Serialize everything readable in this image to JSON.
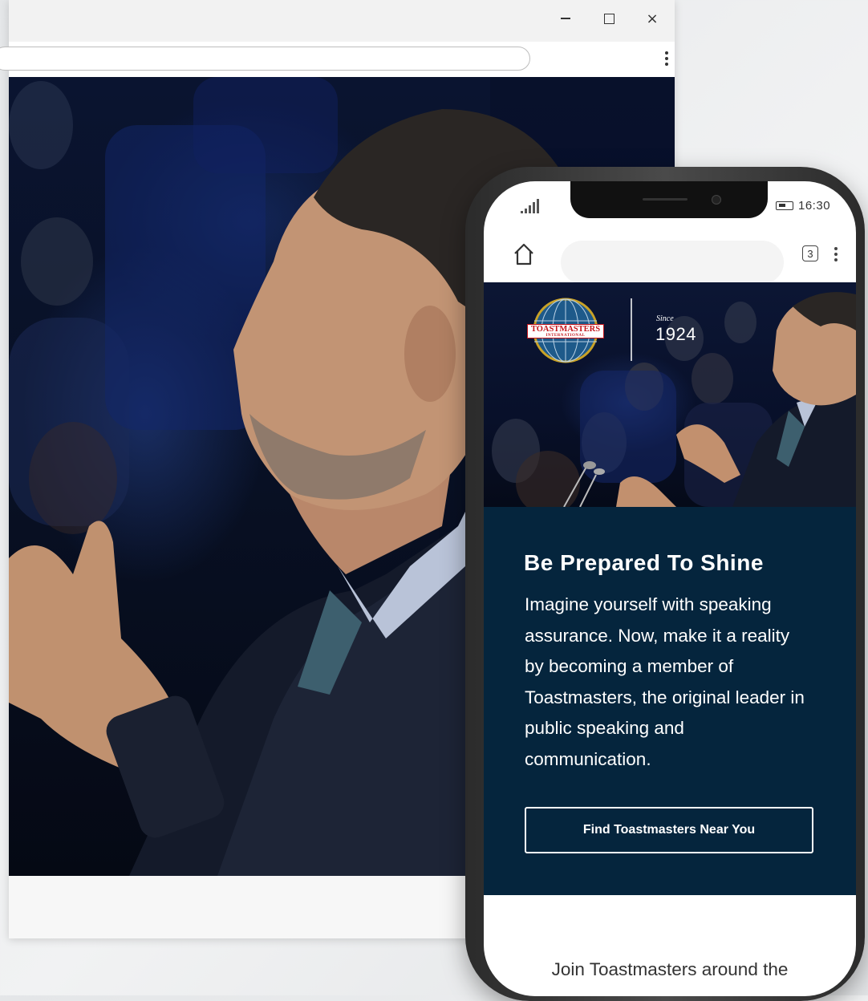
{
  "desktop_window": {
    "minimize_icon": "minimize-icon",
    "maximize_icon": "maximize-icon",
    "close_glyph": "×",
    "menu_icon": "kebab-menu-icon"
  },
  "phone": {
    "status_bar": {
      "time": "16:30",
      "signal_icon": "signal-bars-icon",
      "battery_icon": "battery-icon"
    },
    "browser": {
      "home_icon": "home-icon",
      "tab_count": "3",
      "menu_icon": "kebab-menu-icon"
    },
    "hero": {
      "logo_text": "TOASTMASTERS",
      "logo_subtext": "INTERNATIONAL",
      "since_label": "Since",
      "year": "1924"
    },
    "card": {
      "headline": "Be Prepared To Shine",
      "body": "Imagine yourself with speaking assurance. Now, make it a reality by becoming a member of Toastmasters, the original leader in public speaking and communication.",
      "cta_label": "Find Toastmasters Near You"
    },
    "footer_text": "Join Toastmasters around the"
  },
  "colors": {
    "card_background": "#05253d",
    "brand_red": "#c4161c",
    "hero_dark": "#08102a"
  }
}
